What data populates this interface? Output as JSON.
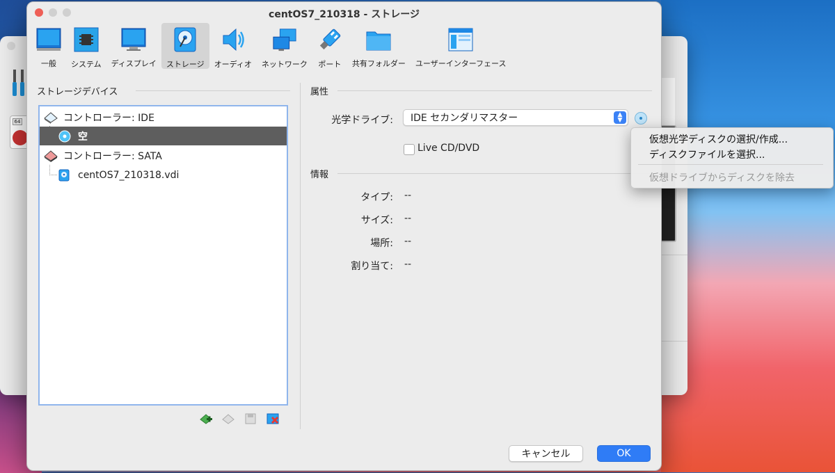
{
  "window": {
    "title": "centOS7_210318 - ストレージ"
  },
  "toolbar": {
    "items": [
      {
        "label": "一般",
        "icon": "general-icon"
      },
      {
        "label": "システム",
        "icon": "system-chip-icon"
      },
      {
        "label": "ディスプレイ",
        "icon": "display-icon"
      },
      {
        "label": "ストレージ",
        "icon": "storage-disk-icon",
        "active": true
      },
      {
        "label": "オーディオ",
        "icon": "speaker-icon"
      },
      {
        "label": "ネットワーク",
        "icon": "network-icon"
      },
      {
        "label": "ポート",
        "icon": "port-plug-icon"
      },
      {
        "label": "共有フォルダー",
        "icon": "folder-icon"
      },
      {
        "label": "ユーザーインターフェース",
        "icon": "window-ui-icon"
      }
    ]
  },
  "storage": {
    "heading": "ストレージデバイス",
    "tree": [
      {
        "label": "コントローラー: IDE",
        "type": "controller"
      },
      {
        "label": "空",
        "type": "optical",
        "selected": true
      },
      {
        "label": "コントローラー: SATA",
        "type": "controller"
      },
      {
        "label": "centOS7_210318.vdi",
        "type": "harddisk"
      }
    ]
  },
  "attributes": {
    "heading": "属性",
    "optical_drive_label": "光学ドライブ:",
    "optical_drive_value": "IDE セカンダリマスター",
    "live_cd_label": "Live CD/DVD",
    "live_cd_checked": false
  },
  "info": {
    "heading": "情報",
    "rows": [
      {
        "label": "タイプ:",
        "value": "--"
      },
      {
        "label": "サイズ:",
        "value": "--"
      },
      {
        "label": "場所:",
        "value": "--"
      },
      {
        "label": "割り当て:",
        "value": "--"
      }
    ]
  },
  "menu": {
    "items": [
      {
        "label": "仮想光学ディスクの選択/作成...",
        "enabled": true
      },
      {
        "label": "ディスクファイルを選択...",
        "enabled": true
      },
      {
        "label": "仮想ドライブからディスクを除去",
        "enabled": false
      }
    ]
  },
  "buttons": {
    "cancel": "キャンセル",
    "ok": "OK"
  },
  "colors": {
    "accent": "#2f7cf6",
    "selection": "#5e5e5e",
    "close": "#ee5f57"
  }
}
